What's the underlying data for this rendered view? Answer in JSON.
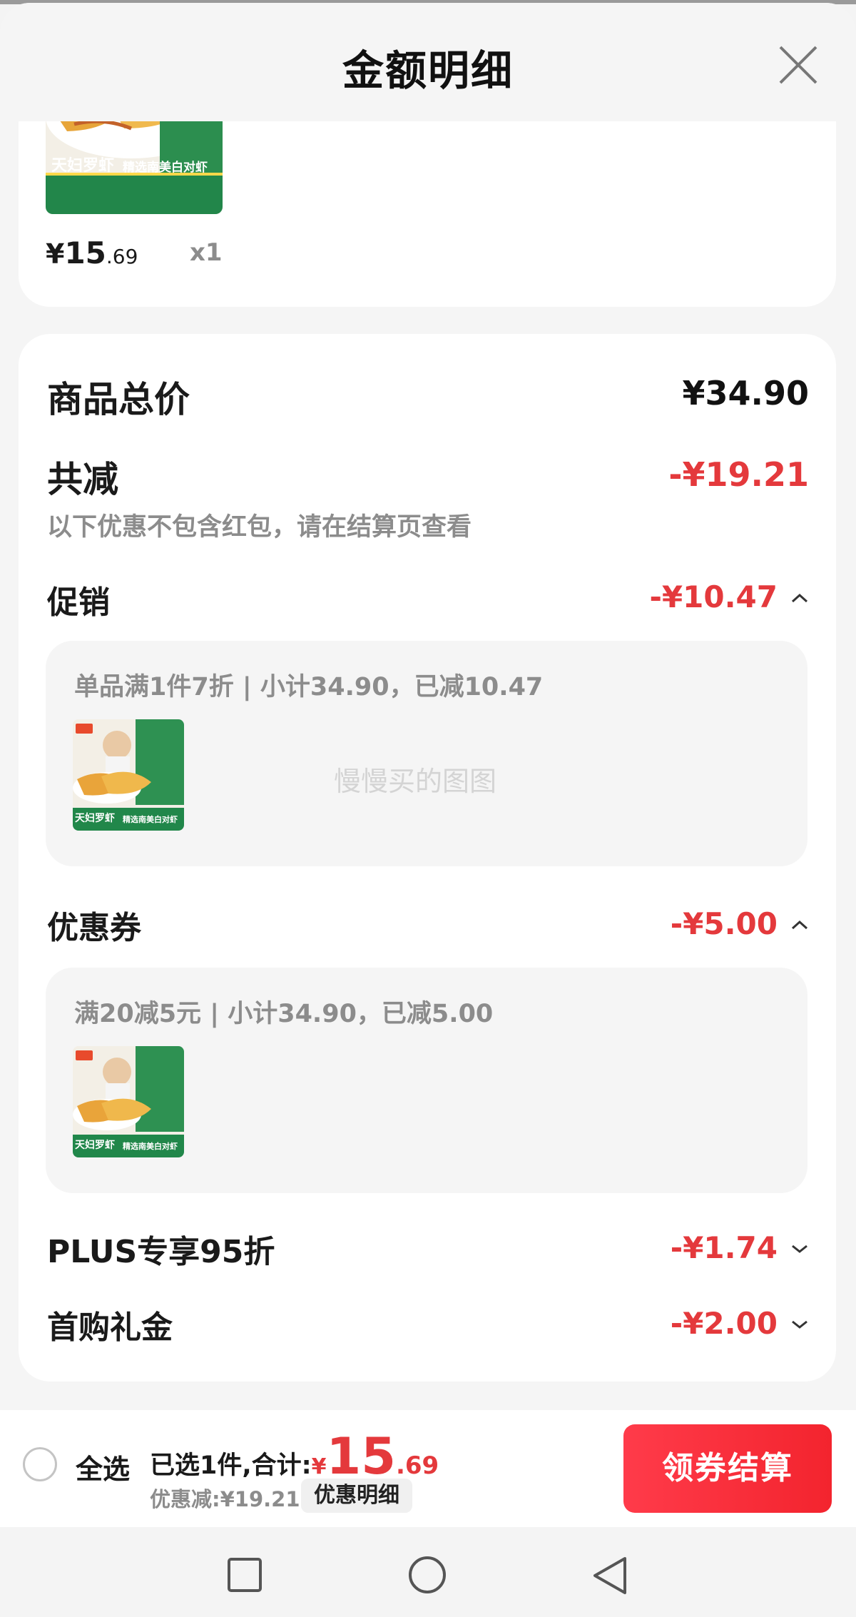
{
  "header": {
    "title": "金额明细"
  },
  "product": {
    "image_text_left": "天妇罗虾",
    "image_text_right": "精选南美白对虾",
    "price_symbol": "¥",
    "price_int": "15",
    "price_dec": ".69",
    "qty": "x1"
  },
  "summary": {
    "total_label": "商品总价",
    "total_value": "¥34.90",
    "reduce_label": "共减",
    "reduce_value": "-¥19.21",
    "reduce_note": "以下优惠不包含红包，请在结算页查看"
  },
  "promotion": {
    "label": "促销",
    "value": "-¥10.47",
    "desc": "单品满1件7折 | 小计34.90，已减10.47",
    "watermark": "慢慢买的图图"
  },
  "coupon": {
    "label": "优惠券",
    "value": "-¥5.00",
    "desc": "满20减5元 | 小计34.90，已减5.00"
  },
  "plus": {
    "label": "PLUS专享95折",
    "value": "-¥1.74"
  },
  "first_buy": {
    "label": "首购礼金",
    "value": "-¥2.00"
  },
  "bottom": {
    "select_all": "全选",
    "selected_prefix": "已选1件,合计:",
    "total_symbol": "¥",
    "total_int": "15",
    "total_dec": ".69",
    "discount_text": "优惠减:¥19.21",
    "detail_button": "优惠明细",
    "checkout_button": "领券结算"
  },
  "colors": {
    "accent": "#e4393c",
    "checkout": "#f3242e",
    "brand_green": "#1f8a43"
  },
  "icons": [
    "close-icon",
    "chevron-up-icon",
    "chevron-down-icon",
    "radio-icon",
    "nav-square-icon",
    "nav-circle-icon",
    "nav-back-icon"
  ]
}
